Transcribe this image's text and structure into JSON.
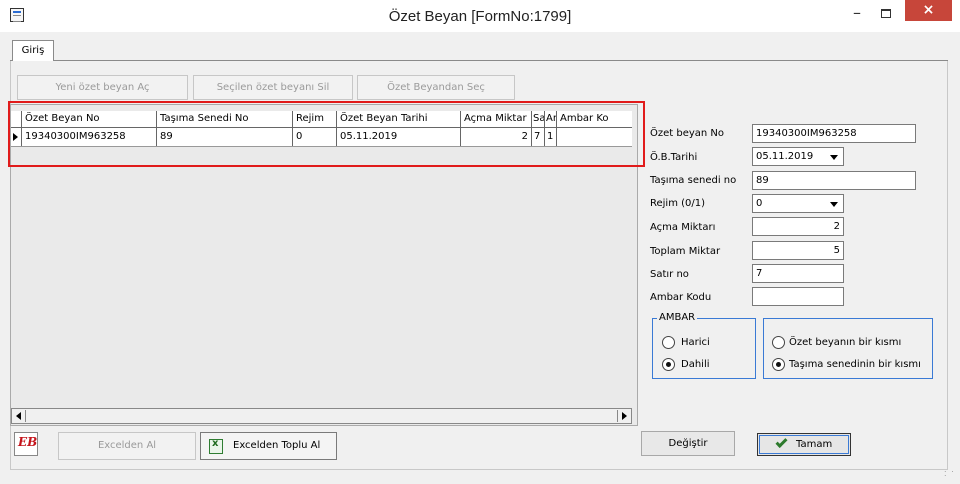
{
  "window": {
    "title": "Özet Beyan [FormNo:1799]",
    "minimize": "–",
    "close": "×"
  },
  "tabs": [
    {
      "label": "Giriş"
    }
  ],
  "toolbar": {
    "new_label": "Yeni özet beyan Aç",
    "delete_label": "Seçilen özet beyanı Sil",
    "select_label": "Özet Beyandan Seç"
  },
  "grid": {
    "columns": [
      "Özet Beyan No",
      "Taşıma Senedi No",
      "Rejim",
      "Özet Beyan Tarihi",
      "Açma Miktar",
      "Sat",
      "Am",
      "Ambar Ko"
    ],
    "rows": [
      [
        "19340300IM963258",
        "89",
        "0",
        "05.11.2019",
        "2",
        "7",
        "1",
        ""
      ]
    ]
  },
  "form": {
    "ozet_beyan_no": {
      "label": "Özet beyan No",
      "value": "19340300IM963258"
    },
    "ob_tarihi": {
      "label": "Ö.B.Tarihi",
      "value": "05.11.2019"
    },
    "tasima_senedi_no": {
      "label": "Taşıma senedi no",
      "value": "89"
    },
    "rejim": {
      "label": "Rejim  (0/1)",
      "value": "0"
    },
    "acma_miktari": {
      "label": "Açma Miktarı",
      "value": "2"
    },
    "toplam_miktar": {
      "label": "Toplam Miktar",
      "value": "5"
    },
    "satir_no": {
      "label": "Satır no",
      "value": "7"
    },
    "ambar_kodu": {
      "label": "Ambar Kodu",
      "value": ""
    },
    "ambar_group": {
      "legend": "AMBAR",
      "options": [
        "Harici",
        "Dahili"
      ],
      "selected": "Dahili"
    },
    "scope_group": {
      "options": [
        "Özet beyanın bir kısmı",
        "Taşıma senedinin bir kısmı"
      ],
      "selected": "Taşıma senedinin bir kısmı"
    }
  },
  "footer": {
    "logo_text": "EB",
    "excel_label": "Excelden Al",
    "excel_bulk_label": "Excelden Toplu Al",
    "change_label": "Değiştir",
    "ok_label": "Tamam"
  },
  "colors": {
    "highlight": "#e11b1b",
    "close_button": "#c7463a",
    "group_border": "#3a7ad5"
  }
}
